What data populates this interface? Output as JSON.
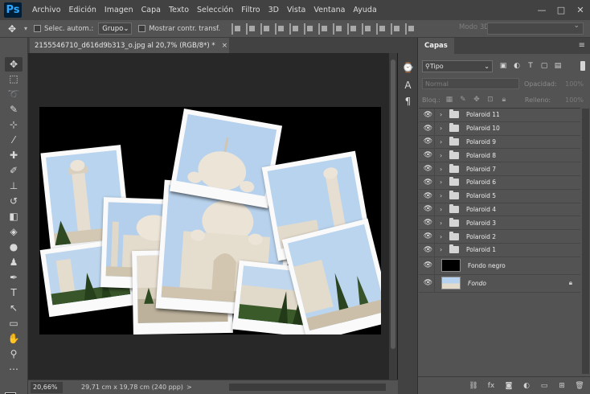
{
  "menu": {
    "logo": "Ps",
    "items": [
      "Archivo",
      "Edición",
      "Imagen",
      "Capa",
      "Texto",
      "Selección",
      "Filtro",
      "3D",
      "Vista",
      "Ventana",
      "Ayuda"
    ],
    "window_controls": [
      "—",
      "□",
      "✕"
    ]
  },
  "options_bar": {
    "auto_select_label": "Selec. autom.:",
    "auto_select_value": "Grupo",
    "show_transform_label": "Mostrar contr. transf.",
    "mode_3d_label": "Modo 3D:"
  },
  "document": {
    "tab_title": "2155546710_d616d9b313_o.jpg al 20,7% (RGB/8*)",
    "tab_modified": "*",
    "tab_close": "×"
  },
  "status": {
    "zoom": "20,66%",
    "doc_info": "29,71 cm x 19,78 cm (240 ppp)",
    "doc_info_arrow": ">"
  },
  "panel": {
    "tab": "Capas",
    "filter_kind": "Tipo",
    "blend_mode": "Normal",
    "opacity_label": "Opacidad:",
    "opacity_value": "100%",
    "lock_label": "Bloq.:",
    "fill_label": "Relleno:",
    "fill_value": "100%",
    "layers": [
      {
        "name": "Polaroid 11",
        "type": "group"
      },
      {
        "name": "Polaroid 10",
        "type": "group"
      },
      {
        "name": "Polaroid 9",
        "type": "group"
      },
      {
        "name": "Polaroid 8",
        "type": "group"
      },
      {
        "name": "Polaroid 7",
        "type": "group"
      },
      {
        "name": "Polaroid 6",
        "type": "group"
      },
      {
        "name": "Polaroid 5",
        "type": "group"
      },
      {
        "name": "Polaroid 4",
        "type": "group"
      },
      {
        "name": "Polaroid 3",
        "type": "group"
      },
      {
        "name": "Polaroid 2",
        "type": "group"
      },
      {
        "name": "Polaroid 1",
        "type": "group"
      },
      {
        "name": "Fondo negro",
        "type": "layer",
        "thumb_color": "#000000"
      },
      {
        "name": "Fondo",
        "type": "background",
        "thumb_color": "#b6d2ef",
        "italic": true
      }
    ]
  },
  "colors": {
    "foreground": "#000000",
    "background": "#ffffff",
    "ps_blue": "#31a8ff",
    "sky": "#b6d2ef",
    "marble": "#e2dacb"
  }
}
